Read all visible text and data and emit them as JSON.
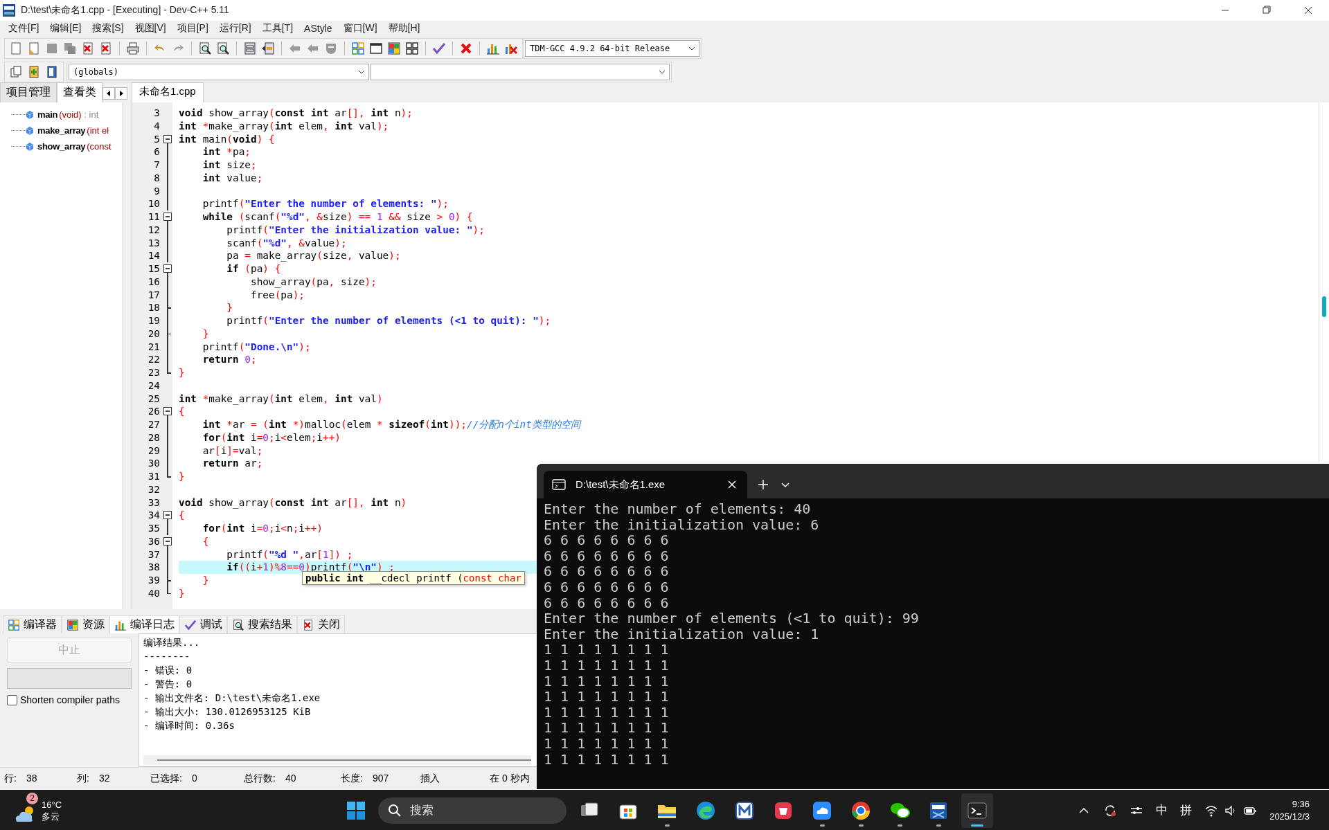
{
  "window": {
    "title": "D:\\test\\未命名1.cpp - [Executing] - Dev-C++ 5.11"
  },
  "menu": [
    "文件[F]",
    "编辑[E]",
    "搜索[S]",
    "视图[V]",
    "项目[P]",
    "运行[R]",
    "工具[T]",
    "AStyle",
    "窗口[W]",
    "帮助[H]"
  ],
  "compiler_select": {
    "value": "TDM-GCC 4.9.2 64-bit Release"
  },
  "scope_select": {
    "value": "(globals)"
  },
  "left_tabs": [
    {
      "label": "项目管理",
      "selected": false
    },
    {
      "label": "查看类",
      "selected": true
    }
  ],
  "class_tree": [
    {
      "name": "main",
      "args": "(void)",
      "type": " : int"
    },
    {
      "name": "make_array",
      "args": "(int el"
    },
    {
      "name": "show_array",
      "args": "(const"
    }
  ],
  "editor_tabs": [
    {
      "label": "未命名1.cpp",
      "selected": true
    }
  ],
  "code": [
    {
      "no": "3",
      "kind": "plain",
      "current": false,
      "tokens": [
        {
          "kind": "keyword",
          "text": "void"
        },
        {
          "kind": "plain",
          "text": " show_array"
        },
        {
          "kind": "punct",
          "text": "("
        },
        {
          "kind": "keyword",
          "text": "const"
        },
        {
          "kind": "keyword",
          "text": " int"
        },
        {
          "kind": "plain",
          "text": " ar"
        },
        {
          "kind": "punct",
          "text": "[],"
        },
        {
          "kind": "keyword",
          "text": " int"
        },
        {
          "kind": "plain",
          "text": " n"
        },
        {
          "kind": "punct",
          "text": ");"
        }
      ]
    },
    {
      "no": "4",
      "kind": "plain",
      "current": false,
      "tokens": [
        {
          "kind": "keyword",
          "text": "int"
        },
        {
          "kind": "punct",
          "text": " *"
        },
        {
          "kind": "plain",
          "text": "make_array"
        },
        {
          "kind": "punct",
          "text": "("
        },
        {
          "kind": "keyword",
          "text": "int"
        },
        {
          "kind": "plain",
          "text": " elem"
        },
        {
          "kind": "punct",
          "text": ","
        },
        {
          "kind": "keyword",
          "text": " int"
        },
        {
          "kind": "plain",
          "text": " val"
        },
        {
          "kind": "punct",
          "text": ");"
        }
      ]
    },
    {
      "no": "5",
      "kind": "foldstart",
      "current": false,
      "tokens": [
        {
          "kind": "keyword",
          "text": "int"
        },
        {
          "kind": "plain",
          "text": " main"
        },
        {
          "kind": "punct",
          "text": "("
        },
        {
          "kind": "keyword",
          "text": "void"
        },
        {
          "kind": "punct",
          "text": ")"
        },
        {
          "kind": "punct",
          "text": " {"
        }
      ]
    },
    {
      "no": "6",
      "kind": "foldline",
      "current": false,
      "tokens": [
        {
          "kind": "keyword",
          "text": "    int"
        },
        {
          "kind": "punct",
          "text": " *"
        },
        {
          "kind": "plain",
          "text": "pa"
        },
        {
          "kind": "punct",
          "text": ";"
        }
      ]
    },
    {
      "no": "7",
      "kind": "foldline",
      "current": false,
      "tokens": [
        {
          "kind": "keyword",
          "text": "    int"
        },
        {
          "kind": "plain",
          "text": " size"
        },
        {
          "kind": "punct",
          "text": ";"
        }
      ]
    },
    {
      "no": "8",
      "kind": "foldline",
      "current": false,
      "tokens": [
        {
          "kind": "keyword",
          "text": "    int"
        },
        {
          "kind": "plain",
          "text": " value"
        },
        {
          "kind": "punct",
          "text": ";"
        }
      ]
    },
    {
      "no": "9",
      "kind": "foldline"
    },
    {
      "no": "10",
      "kind": "foldline",
      "current": false,
      "tokens": [
        {
          "kind": "plain",
          "text": "    printf"
        },
        {
          "kind": "punct",
          "text": "("
        },
        {
          "kind": "string",
          "text": "\"Enter the number of elements: \""
        },
        {
          "kind": "punct",
          "text": ");"
        }
      ]
    },
    {
      "no": "11",
      "kind": "foldstart",
      "current": false,
      "tokens": [
        {
          "kind": "keyword",
          "text": "    while"
        },
        {
          "kind": "punct",
          "text": " ("
        },
        {
          "kind": "plain",
          "text": "scanf"
        },
        {
          "kind": "punct",
          "text": "("
        },
        {
          "kind": "string",
          "text": "\"%d\""
        },
        {
          "kind": "punct",
          "text": ","
        },
        {
          "kind": "punct",
          "text": " &"
        },
        {
          "kind": "plain",
          "text": "size"
        },
        {
          "kind": "punct",
          "text": ")"
        },
        {
          "kind": "punct",
          "text": " =="
        },
        {
          "kind": "number",
          "text": " 1"
        },
        {
          "kind": "punct",
          "text": " &&"
        },
        {
          "kind": "plain",
          "text": " size "
        },
        {
          "kind": "punct",
          "text": ">"
        },
        {
          "kind": "number",
          "text": " 0"
        },
        {
          "kind": "punct",
          "text": ")"
        },
        {
          "kind": "punct",
          "text": " {"
        }
      ]
    },
    {
      "no": "12",
      "kind": "foldline",
      "current": false,
      "tokens": [
        {
          "kind": "plain",
          "text": "        printf"
        },
        {
          "kind": "punct",
          "text": "("
        },
        {
          "kind": "string",
          "text": "\"Enter the initialization value: \""
        },
        {
          "kind": "punct",
          "text": ");"
        }
      ]
    },
    {
      "no": "13",
      "kind": "foldline",
      "current": false,
      "tokens": [
        {
          "kind": "plain",
          "text": "        scanf"
        },
        {
          "kind": "punct",
          "text": "("
        },
        {
          "kind": "string",
          "text": "\"%d\""
        },
        {
          "kind": "punct",
          "text": ","
        },
        {
          "kind": "punct",
          "text": " &"
        },
        {
          "kind": "plain",
          "text": "value"
        },
        {
          "kind": "punct",
          "text": ");"
        }
      ]
    },
    {
      "no": "14",
      "kind": "foldline",
      "current": false,
      "tokens": [
        {
          "kind": "plain",
          "text": "        pa "
        },
        {
          "kind": "punct",
          "text": "="
        },
        {
          "kind": "plain",
          "text": " make_array"
        },
        {
          "kind": "punct",
          "text": "("
        },
        {
          "kind": "plain",
          "text": "size"
        },
        {
          "kind": "punct",
          "text": ","
        },
        {
          "kind": "plain",
          "text": " value"
        },
        {
          "kind": "punct",
          "text": ");"
        }
      ]
    },
    {
      "no": "15",
      "kind": "foldstart",
      "current": false,
      "tokens": [
        {
          "kind": "keyword",
          "text": "        if"
        },
        {
          "kind": "punct",
          "text": " ("
        },
        {
          "kind": "plain",
          "text": "pa"
        },
        {
          "kind": "punct",
          "text": ")"
        },
        {
          "kind": "punct",
          "text": " {"
        }
      ]
    },
    {
      "no": "16",
      "kind": "foldline",
      "current": false,
      "tokens": [
        {
          "kind": "plain",
          "text": "            show_array"
        },
        {
          "kind": "punct",
          "text": "("
        },
        {
          "kind": "plain",
          "text": "pa"
        },
        {
          "kind": "punct",
          "text": ","
        },
        {
          "kind": "plain",
          "text": " size"
        },
        {
          "kind": "punct",
          "text": ");"
        }
      ]
    },
    {
      "no": "17",
      "kind": "foldline",
      "current": false,
      "tokens": [
        {
          "kind": "plain",
          "text": "            free"
        },
        {
          "kind": "punct",
          "text": "("
        },
        {
          "kind": "plain",
          "text": "pa"
        },
        {
          "kind": "punct",
          "text": ");"
        }
      ]
    },
    {
      "no": "18",
      "kind": "foldbranch",
      "current": false,
      "tokens": [
        {
          "kind": "punct",
          "text": "        }"
        }
      ]
    },
    {
      "no": "19",
      "kind": "foldline",
      "current": false,
      "tokens": [
        {
          "kind": "plain",
          "text": "        printf"
        },
        {
          "kind": "punct",
          "text": "("
        },
        {
          "kind": "string",
          "text": "\"Enter the number of elements (<1 to quit): \""
        },
        {
          "kind": "punct",
          "text": ");"
        }
      ]
    },
    {
      "no": "20",
      "kind": "foldbranch",
      "current": false,
      "tokens": [
        {
          "kind": "punct",
          "text": "    }"
        }
      ]
    },
    {
      "no": "21",
      "kind": "foldline",
      "current": false,
      "tokens": [
        {
          "kind": "plain",
          "text": "    printf"
        },
        {
          "kind": "punct",
          "text": "("
        },
        {
          "kind": "string",
          "text": "\"Done.\\n\""
        },
        {
          "kind": "punct",
          "text": ");"
        }
      ]
    },
    {
      "no": "22",
      "kind": "foldline",
      "current": false,
      "tokens": [
        {
          "kind": "keyword",
          "text": "    return"
        },
        {
          "kind": "number",
          "text": " 0"
        },
        {
          "kind": "punct",
          "text": ";"
        }
      ]
    },
    {
      "no": "23",
      "kind": "foldend",
      "current": false,
      "tokens": [
        {
          "kind": "punct",
          "text": "}"
        }
      ]
    },
    {
      "no": "24",
      "kind": "plain"
    },
    {
      "no": "25",
      "kind": "plain",
      "current": false,
      "tokens": [
        {
          "kind": "keyword",
          "text": "int"
        },
        {
          "kind": "punct",
          "text": " *"
        },
        {
          "kind": "plain",
          "text": "make_array"
        },
        {
          "kind": "punct",
          "text": "("
        },
        {
          "kind": "keyword",
          "text": "int"
        },
        {
          "kind": "plain",
          "text": " elem"
        },
        {
          "kind": "punct",
          "text": ","
        },
        {
          "kind": "keyword",
          "text": " int"
        },
        {
          "kind": "plain",
          "text": " val"
        },
        {
          "kind": "punct",
          "text": ")"
        }
      ]
    },
    {
      "no": "26",
      "kind": "foldstart",
      "current": false,
      "tokens": [
        {
          "kind": "punct",
          "text": "{"
        }
      ]
    },
    {
      "no": "27",
      "kind": "foldline",
      "current": false,
      "tokens": [
        {
          "kind": "keyword",
          "text": "    int"
        },
        {
          "kind": "punct",
          "text": " *"
        },
        {
          "kind": "plain",
          "text": "ar "
        },
        {
          "kind": "punct",
          "text": "="
        },
        {
          "kind": "punct",
          "text": " ("
        },
        {
          "kind": "keyword",
          "text": "int"
        },
        {
          "kind": "punct",
          "text": " *)"
        },
        {
          "kind": "plain",
          "text": "malloc"
        },
        {
          "kind": "punct",
          "text": "("
        },
        {
          "kind": "plain",
          "text": "elem "
        },
        {
          "kind": "punct",
          "text": "*"
        },
        {
          "kind": "keyword",
          "text": " sizeof"
        },
        {
          "kind": "punct",
          "text": "("
        },
        {
          "kind": "keyword",
          "text": "int"
        },
        {
          "kind": "punct",
          "text": "));"
        },
        {
          "kind": "comment",
          "text": "//分配n个int类型的空间"
        }
      ]
    },
    {
      "no": "28",
      "kind": "foldline",
      "current": false,
      "tokens": [
        {
          "kind": "keyword",
          "text": "    for"
        },
        {
          "kind": "punct",
          "text": "("
        },
        {
          "kind": "keyword",
          "text": "int"
        },
        {
          "kind": "plain",
          "text": " i"
        },
        {
          "kind": "punct",
          "text": "="
        },
        {
          "kind": "number",
          "text": "0"
        },
        {
          "kind": "punct",
          "text": ";"
        },
        {
          "kind": "plain",
          "text": "i"
        },
        {
          "kind": "punct",
          "text": "<"
        },
        {
          "kind": "plain",
          "text": "elem"
        },
        {
          "kind": "punct",
          "text": ";"
        },
        {
          "kind": "plain",
          "text": "i"
        },
        {
          "kind": "punct",
          "text": "++)"
        }
      ]
    },
    {
      "no": "29",
      "kind": "foldline",
      "current": false,
      "tokens": [
        {
          "kind": "plain",
          "text": "    ar"
        },
        {
          "kind": "punct",
          "text": "["
        },
        {
          "kind": "plain",
          "text": "i"
        },
        {
          "kind": "punct",
          "text": "]="
        },
        {
          "kind": "plain",
          "text": "val"
        },
        {
          "kind": "punct",
          "text": ";"
        }
      ]
    },
    {
      "no": "30",
      "kind": "foldline",
      "current": false,
      "tokens": [
        {
          "kind": "keyword",
          "text": "    return"
        },
        {
          "kind": "plain",
          "text": " ar"
        },
        {
          "kind": "punct",
          "text": ";"
        }
      ]
    },
    {
      "no": "31",
      "kind": "foldend",
      "current": false,
      "tokens": [
        {
          "kind": "punct",
          "text": "}"
        }
      ]
    },
    {
      "no": "32",
      "kind": "plain"
    },
    {
      "no": "33",
      "kind": "plain",
      "current": false,
      "tokens": [
        {
          "kind": "keyword",
          "text": "void"
        },
        {
          "kind": "plain",
          "text": " show_array"
        },
        {
          "kind": "punct",
          "text": "("
        },
        {
          "kind": "keyword",
          "text": "const"
        },
        {
          "kind": "keyword",
          "text": " int"
        },
        {
          "kind": "plain",
          "text": " ar"
        },
        {
          "kind": "punct",
          "text": "[],"
        },
        {
          "kind": "keyword",
          "text": " int"
        },
        {
          "kind": "plain",
          "text": " n"
        },
        {
          "kind": "punct",
          "text": ")"
        }
      ]
    },
    {
      "no": "34",
      "kind": "foldstart",
      "current": false,
      "tokens": [
        {
          "kind": "punct",
          "text": "{"
        }
      ]
    },
    {
      "no": "35",
      "kind": "foldline",
      "current": false,
      "tokens": [
        {
          "kind": "keyword",
          "text": "    for"
        },
        {
          "kind": "punct",
          "text": "("
        },
        {
          "kind": "keyword",
          "text": "int"
        },
        {
          "kind": "plain",
          "text": " i"
        },
        {
          "kind": "punct",
          "text": "="
        },
        {
          "kind": "number",
          "text": "0"
        },
        {
          "kind": "punct",
          "text": ";"
        },
        {
          "kind": "plain",
          "text": "i"
        },
        {
          "kind": "punct",
          "text": "<"
        },
        {
          "kind": "plain",
          "text": "n"
        },
        {
          "kind": "punct",
          "text": ";"
        },
        {
          "kind": "plain",
          "text": "i"
        },
        {
          "kind": "punct",
          "text": "++)"
        }
      ]
    },
    {
      "no": "36",
      "kind": "foldstart",
      "current": false,
      "tokens": [
        {
          "kind": "punct",
          "text": "    {"
        }
      ]
    },
    {
      "no": "37",
      "kind": "foldline",
      "current": false,
      "tokens": [
        {
          "kind": "plain",
          "text": "        printf"
        },
        {
          "kind": "punct",
          "text": "("
        },
        {
          "kind": "string",
          "text": "\"%d \""
        },
        {
          "kind": "punct",
          "text": ","
        },
        {
          "kind": "plain",
          "text": "ar"
        },
        {
          "kind": "punct",
          "text": "["
        },
        {
          "kind": "number",
          "text": "1"
        },
        {
          "kind": "punct",
          "text": "])"
        },
        {
          "kind": "punct",
          "text": " ;"
        }
      ]
    },
    {
      "no": "38",
      "kind": "foldline",
      "current": true,
      "tokens": [
        {
          "kind": "keyword",
          "text": "        if"
        },
        {
          "kind": "punct",
          "text": "(("
        },
        {
          "kind": "plain",
          "text": "i"
        },
        {
          "kind": "punct",
          "text": "+"
        },
        {
          "kind": "number",
          "text": "1"
        },
        {
          "kind": "punct",
          "text": ")%"
        },
        {
          "kind": "number",
          "text": "8"
        },
        {
          "kind": "punct",
          "text": "=="
        },
        {
          "kind": "number",
          "text": "0"
        },
        {
          "kind": "punct",
          "text": ")"
        },
        {
          "kind": "plain",
          "text": "printf"
        },
        {
          "kind": "punct",
          "text": "("
        },
        {
          "kind": "string",
          "text": "\"\\n\""
        },
        {
          "kind": "punct",
          "text": ")"
        },
        {
          "kind": "punct",
          "text": " ;"
        }
      ]
    },
    {
      "no": "39",
      "kind": "foldbranch",
      "current": false,
      "tokens": [
        {
          "kind": "punct",
          "text": "    }"
        }
      ]
    },
    {
      "no": "40",
      "kind": "foldend",
      "current": false,
      "tokens": [
        {
          "kind": "punct",
          "text": "}"
        }
      ]
    }
  ],
  "tooltip": {
    "tokens": [
      {
        "kind": "keyword",
        "text": "public int"
      },
      {
        "kind": "plain",
        "text": " __cdecl printf ("
      },
      {
        "kind": "punct",
        "text": "const char"
      }
    ]
  },
  "bottom_tabs": [
    {
      "label": "编译器",
      "selected": false
    },
    {
      "label": "资源",
      "selected": false
    },
    {
      "label": "编译日志",
      "selected": true
    },
    {
      "label": "调试",
      "selected": false
    },
    {
      "label": "搜索结果",
      "selected": false
    },
    {
      "label": "关闭",
      "selected": false
    }
  ],
  "abort_button": {
    "label": "中止",
    "disabled": true
  },
  "progress": {
    "level": 0
  },
  "shorten_paths": {
    "label": "Shorten compiler paths",
    "checked": false
  },
  "compile_log": [
    "编译结果...",
    "--------",
    "- 错误: 0",
    "- 警告: 0",
    "- 输出文件名: D:\\test\\未命名1.exe",
    "- 输出大小: 130.0126953125 KiB",
    "- 编译时间: 0.36s"
  ],
  "status_bar": [
    {
      "label": "行:",
      "value": "38"
    },
    {
      "label": "列:",
      "value": "32"
    },
    {
      "label": "已选择:",
      "value": "0"
    },
    {
      "label": "总行数:",
      "value": "40"
    },
    {
      "label": "长度:",
      "value": "907"
    },
    {
      "label": "插入"
    },
    {
      "label": "在 0 秒内"
    }
  ],
  "terminal": {
    "tab_title": "D:\\test\\未命名1.exe",
    "lines": [
      "Enter the number of elements: 40",
      "Enter the initialization value: 6",
      "6 6 6 6 6 6 6 6",
      "6 6 6 6 6 6 6 6",
      "6 6 6 6 6 6 6 6",
      "6 6 6 6 6 6 6 6",
      "6 6 6 6 6 6 6 6",
      "Enter the number of elements (<1 to quit): 99",
      "Enter the initialization value: 1",
      "1 1 1 1 1 1 1 1",
      "1 1 1 1 1 1 1 1",
      "1 1 1 1 1 1 1 1",
      "1 1 1 1 1 1 1 1",
      "1 1 1 1 1 1 1 1",
      "1 1 1 1 1 1 1 1",
      "1 1 1 1 1 1 1 1",
      "1 1 1 1 1 1 1 1"
    ]
  },
  "taskbar": {
    "weather": {
      "badge": "2",
      "temp": "16°C",
      "desc": "多云"
    },
    "search": {
      "placeholder": "搜索"
    },
    "apps": [
      {
        "kind": "taskview",
        "running": false,
        "selected": false
      },
      {
        "kind": "store",
        "running": false,
        "selected": false
      },
      {
        "kind": "folder",
        "running": true,
        "selected": false
      },
      {
        "kind": "edge",
        "running": false,
        "selected": false
      },
      {
        "kind": "mtile",
        "running": false,
        "selected": false
      },
      {
        "kind": "redtile",
        "running": false,
        "selected": false
      },
      {
        "kind": "cloud",
        "running": true,
        "selected": false
      },
      {
        "kind": "chrome",
        "running": true,
        "selected": false
      },
      {
        "kind": "wechat",
        "running": true,
        "selected": false
      },
      {
        "kind": "dev",
        "running": true,
        "selected": false
      },
      {
        "kind": "terminal",
        "running": true,
        "selected": true
      }
    ],
    "ime": [
      "中",
      "拼"
    ],
    "time": "9:36",
    "date": "2025/12/3"
  }
}
